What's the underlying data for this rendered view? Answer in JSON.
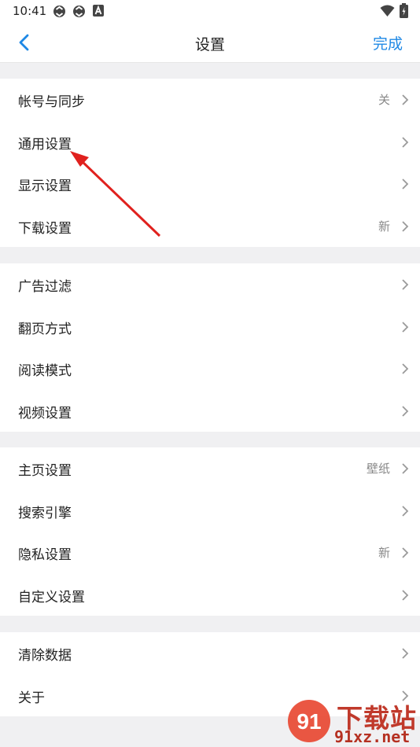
{
  "status_bar": {
    "time": "10:41"
  },
  "nav": {
    "title": "设置",
    "done_label": "完成"
  },
  "groups": [
    {
      "items": [
        {
          "label": "帐号与同步",
          "value": "关"
        },
        {
          "label": "通用设置",
          "value": ""
        },
        {
          "label": "显示设置",
          "value": ""
        },
        {
          "label": "下载设置",
          "value": "新"
        }
      ]
    },
    {
      "items": [
        {
          "label": "广告过滤",
          "value": ""
        },
        {
          "label": "翻页方式",
          "value": ""
        },
        {
          "label": "阅读模式",
          "value": ""
        },
        {
          "label": "视频设置",
          "value": ""
        }
      ]
    },
    {
      "items": [
        {
          "label": "主页设置",
          "value": "壁纸"
        },
        {
          "label": "搜索引擎",
          "value": ""
        },
        {
          "label": "隐私设置",
          "value": "新"
        },
        {
          "label": "自定义设置",
          "value": ""
        }
      ]
    },
    {
      "items": [
        {
          "label": "清除数据",
          "value": ""
        },
        {
          "label": "关于",
          "value": ""
        }
      ]
    }
  ],
  "watermark": {
    "brand": "下载站",
    "site": "91xz.net"
  },
  "colors": {
    "accent": "#1e88e5",
    "annotation_arrow": "#e0211e",
    "background": "#f0f0f2"
  },
  "icons": [
    "sync-icon",
    "sync-icon",
    "notification-a-icon",
    "wifi-icon",
    "battery-icon",
    "back-arrow-icon",
    "chevron-right-icon"
  ]
}
